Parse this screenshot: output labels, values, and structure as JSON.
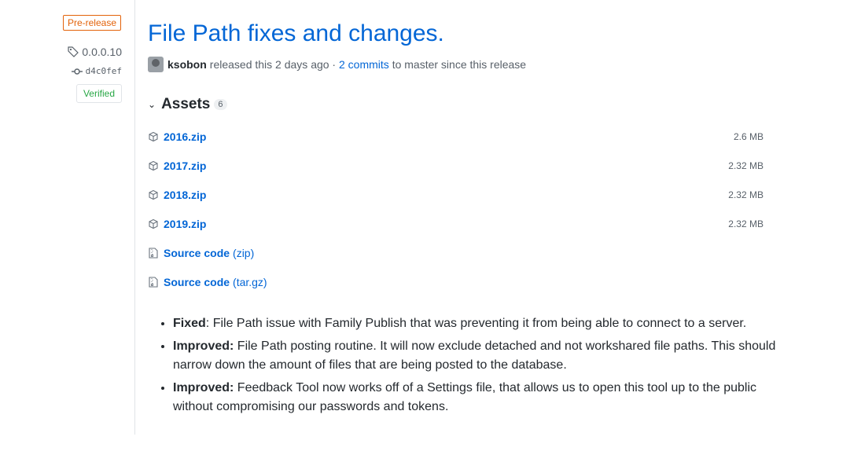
{
  "meta": {
    "badge": "Pre-release",
    "tag": "0.0.0.10",
    "commit": "d4c0fef",
    "verified": "Verified"
  },
  "release": {
    "title": "File Path fixes and changes.",
    "author": "ksobon",
    "released_text": "released this 2 days ago ·",
    "commits_link": "2 commits",
    "commits_suffix": "to master since this release"
  },
  "assets": {
    "heading": "Assets",
    "count": "6",
    "items": [
      {
        "name": "2016.zip",
        "size": "2.6 MB",
        "icon": "package-icon"
      },
      {
        "name": "2017.zip",
        "size": "2.32 MB",
        "icon": "package-icon"
      },
      {
        "name": "2018.zip",
        "size": "2.32 MB",
        "icon": "package-icon"
      },
      {
        "name": "2019.zip",
        "size": "2.32 MB",
        "icon": "package-icon"
      },
      {
        "name": "Source code",
        "sub": "(zip)",
        "icon": "file-zip-icon"
      },
      {
        "name": "Source code",
        "sub": "(tar.gz)",
        "icon": "file-zip-icon"
      }
    ]
  },
  "notes": [
    {
      "label": "Fixed",
      "text": ": File Path issue with Family Publish that was preventing it from being able to connect to a server."
    },
    {
      "label": "Improved:",
      "text": " File Path posting routine. It will now exclude detached and not workshared file paths. This should narrow down the amount of files that are being posted to the database."
    },
    {
      "label": "Improved:",
      "text": " Feedback Tool now works off of a Settings file, that allows us to open this tool up to the public without compromising our passwords and tokens."
    }
  ]
}
